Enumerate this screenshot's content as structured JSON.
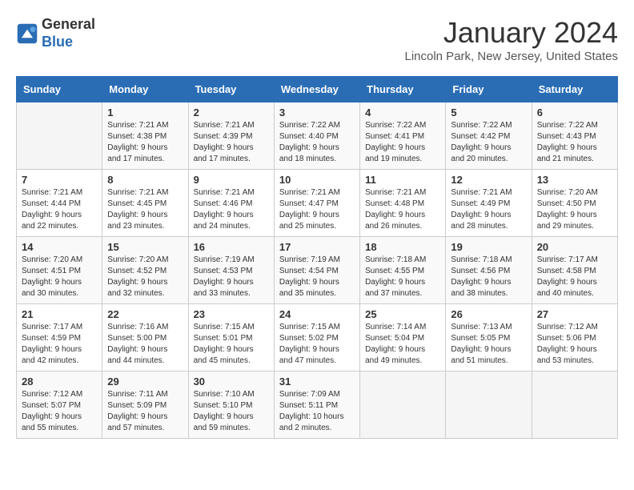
{
  "logo": {
    "general": "General",
    "blue": "Blue"
  },
  "header": {
    "month": "January 2024",
    "location": "Lincoln Park, New Jersey, United States"
  },
  "weekdays": [
    "Sunday",
    "Monday",
    "Tuesday",
    "Wednesday",
    "Thursday",
    "Friday",
    "Saturday"
  ],
  "weeks": [
    [
      {
        "day": "",
        "info": ""
      },
      {
        "day": "1",
        "info": "Sunrise: 7:21 AM\nSunset: 4:38 PM\nDaylight: 9 hours\nand 17 minutes."
      },
      {
        "day": "2",
        "info": "Sunrise: 7:21 AM\nSunset: 4:39 PM\nDaylight: 9 hours\nand 17 minutes."
      },
      {
        "day": "3",
        "info": "Sunrise: 7:22 AM\nSunset: 4:40 PM\nDaylight: 9 hours\nand 18 minutes."
      },
      {
        "day": "4",
        "info": "Sunrise: 7:22 AM\nSunset: 4:41 PM\nDaylight: 9 hours\nand 19 minutes."
      },
      {
        "day": "5",
        "info": "Sunrise: 7:22 AM\nSunset: 4:42 PM\nDaylight: 9 hours\nand 20 minutes."
      },
      {
        "day": "6",
        "info": "Sunrise: 7:22 AM\nSunset: 4:43 PM\nDaylight: 9 hours\nand 21 minutes."
      }
    ],
    [
      {
        "day": "7",
        "info": "Sunrise: 7:21 AM\nSunset: 4:44 PM\nDaylight: 9 hours\nand 22 minutes."
      },
      {
        "day": "8",
        "info": "Sunrise: 7:21 AM\nSunset: 4:45 PM\nDaylight: 9 hours\nand 23 minutes."
      },
      {
        "day": "9",
        "info": "Sunrise: 7:21 AM\nSunset: 4:46 PM\nDaylight: 9 hours\nand 24 minutes."
      },
      {
        "day": "10",
        "info": "Sunrise: 7:21 AM\nSunset: 4:47 PM\nDaylight: 9 hours\nand 25 minutes."
      },
      {
        "day": "11",
        "info": "Sunrise: 7:21 AM\nSunset: 4:48 PM\nDaylight: 9 hours\nand 26 minutes."
      },
      {
        "day": "12",
        "info": "Sunrise: 7:21 AM\nSunset: 4:49 PM\nDaylight: 9 hours\nand 28 minutes."
      },
      {
        "day": "13",
        "info": "Sunrise: 7:20 AM\nSunset: 4:50 PM\nDaylight: 9 hours\nand 29 minutes."
      }
    ],
    [
      {
        "day": "14",
        "info": "Sunrise: 7:20 AM\nSunset: 4:51 PM\nDaylight: 9 hours\nand 30 minutes."
      },
      {
        "day": "15",
        "info": "Sunrise: 7:20 AM\nSunset: 4:52 PM\nDaylight: 9 hours\nand 32 minutes."
      },
      {
        "day": "16",
        "info": "Sunrise: 7:19 AM\nSunset: 4:53 PM\nDaylight: 9 hours\nand 33 minutes."
      },
      {
        "day": "17",
        "info": "Sunrise: 7:19 AM\nSunset: 4:54 PM\nDaylight: 9 hours\nand 35 minutes."
      },
      {
        "day": "18",
        "info": "Sunrise: 7:18 AM\nSunset: 4:55 PM\nDaylight: 9 hours\nand 37 minutes."
      },
      {
        "day": "19",
        "info": "Sunrise: 7:18 AM\nSunset: 4:56 PM\nDaylight: 9 hours\nand 38 minutes."
      },
      {
        "day": "20",
        "info": "Sunrise: 7:17 AM\nSunset: 4:58 PM\nDaylight: 9 hours\nand 40 minutes."
      }
    ],
    [
      {
        "day": "21",
        "info": "Sunrise: 7:17 AM\nSunset: 4:59 PM\nDaylight: 9 hours\nand 42 minutes."
      },
      {
        "day": "22",
        "info": "Sunrise: 7:16 AM\nSunset: 5:00 PM\nDaylight: 9 hours\nand 44 minutes."
      },
      {
        "day": "23",
        "info": "Sunrise: 7:15 AM\nSunset: 5:01 PM\nDaylight: 9 hours\nand 45 minutes."
      },
      {
        "day": "24",
        "info": "Sunrise: 7:15 AM\nSunset: 5:02 PM\nDaylight: 9 hours\nand 47 minutes."
      },
      {
        "day": "25",
        "info": "Sunrise: 7:14 AM\nSunset: 5:04 PM\nDaylight: 9 hours\nand 49 minutes."
      },
      {
        "day": "26",
        "info": "Sunrise: 7:13 AM\nSunset: 5:05 PM\nDaylight: 9 hours\nand 51 minutes."
      },
      {
        "day": "27",
        "info": "Sunrise: 7:12 AM\nSunset: 5:06 PM\nDaylight: 9 hours\nand 53 minutes."
      }
    ],
    [
      {
        "day": "28",
        "info": "Sunrise: 7:12 AM\nSunset: 5:07 PM\nDaylight: 9 hours\nand 55 minutes."
      },
      {
        "day": "29",
        "info": "Sunrise: 7:11 AM\nSunset: 5:09 PM\nDaylight: 9 hours\nand 57 minutes."
      },
      {
        "day": "30",
        "info": "Sunrise: 7:10 AM\nSunset: 5:10 PM\nDaylight: 9 hours\nand 59 minutes."
      },
      {
        "day": "31",
        "info": "Sunrise: 7:09 AM\nSunset: 5:11 PM\nDaylight: 10 hours\nand 2 minutes."
      },
      {
        "day": "",
        "info": ""
      },
      {
        "day": "",
        "info": ""
      },
      {
        "day": "",
        "info": ""
      }
    ]
  ]
}
